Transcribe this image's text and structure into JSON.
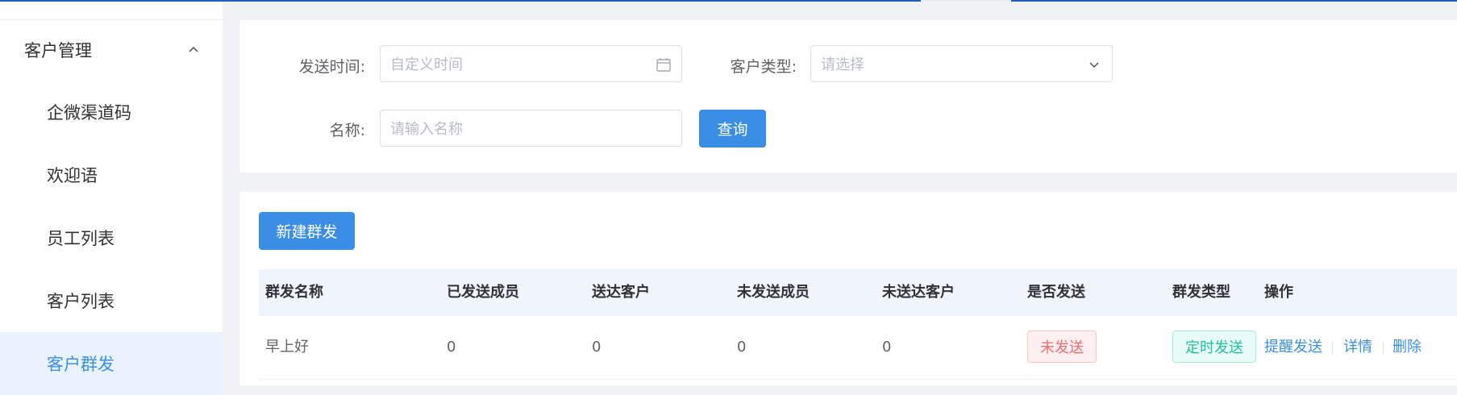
{
  "sidebar": {
    "parent_label": "客户管理",
    "items": [
      {
        "label": "企微渠道码"
      },
      {
        "label": "欢迎语"
      },
      {
        "label": "员工列表"
      },
      {
        "label": "客户列表"
      },
      {
        "label": "客户群发",
        "active": true
      }
    ]
  },
  "filters": {
    "send_time_label": "发送时间:",
    "send_time_placeholder": "自定义时间",
    "customer_type_label": "客户类型:",
    "customer_type_placeholder": "请选择",
    "name_label": "名称:",
    "name_placeholder": "请输入名称",
    "query_label": "查询"
  },
  "toolbar": {
    "new_broadcast_label": "新建群发"
  },
  "table": {
    "columns": [
      "群发名称",
      "已发送成员",
      "送达客户",
      "未发送成员",
      "未送达客户",
      "是否发送",
      "群发类型",
      "操作"
    ],
    "rows": [
      {
        "name": "早上好",
        "sent_members": "0",
        "delivered_customers": "0",
        "unsent_members": "0",
        "undelivered_customers": "0",
        "sent_status": "未发送",
        "broadcast_type": "定时发送",
        "actions": [
          "提醒发送",
          "详情",
          "删除"
        ]
      }
    ]
  },
  "colors": {
    "primary": "#3a8ee6",
    "danger": "#f56c6c",
    "success_cyan": "#1fc2a0",
    "active_menu_bg": "#e8f3ff"
  },
  "icons": {
    "menu_collapse": "chevron-up-icon",
    "date_picker": "calendar-icon",
    "select": "chevron-down-icon"
  }
}
